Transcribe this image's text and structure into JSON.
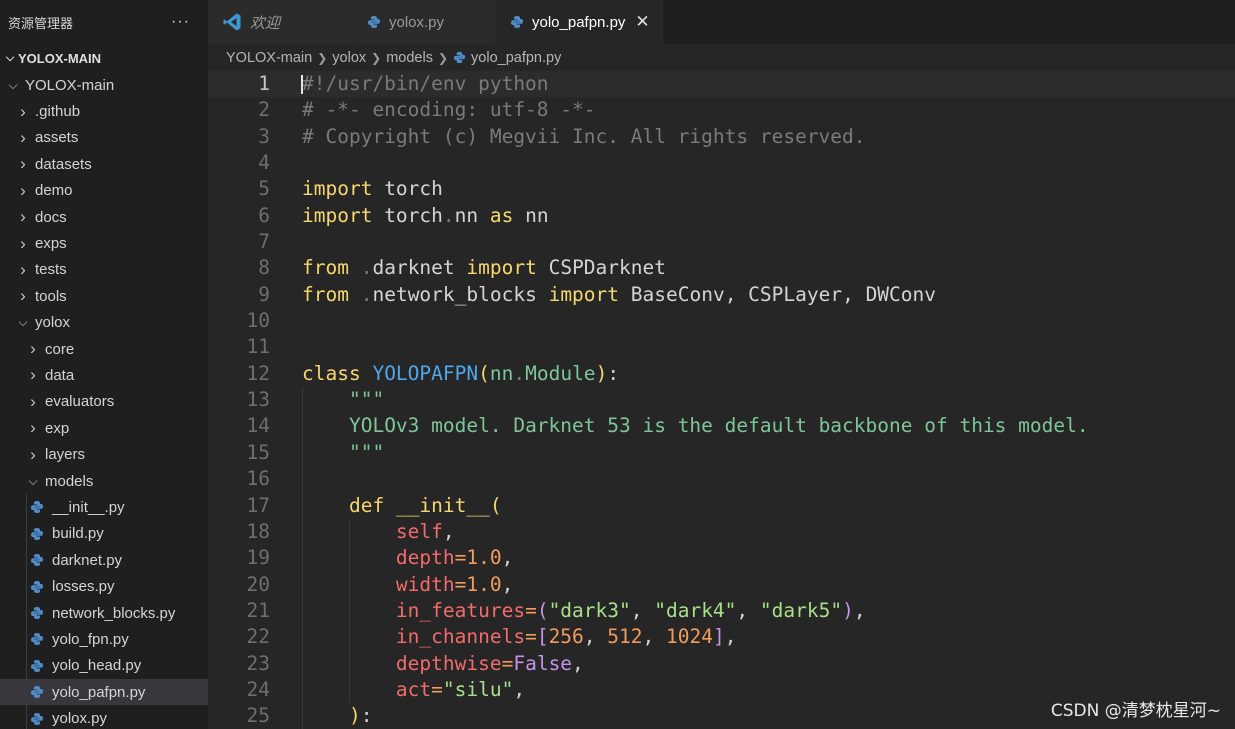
{
  "sidebar": {
    "title": "资源管理器",
    "more": "···",
    "section": "YOLOX-MAIN",
    "tree": [
      {
        "label": "YOLOX-main",
        "depth": 0,
        "kind": "folder",
        "expanded": true
      },
      {
        "label": ".github",
        "depth": 1,
        "kind": "folder",
        "expanded": false
      },
      {
        "label": "assets",
        "depth": 1,
        "kind": "folder",
        "expanded": false
      },
      {
        "label": "datasets",
        "depth": 1,
        "kind": "folder",
        "expanded": false
      },
      {
        "label": "demo",
        "depth": 1,
        "kind": "folder",
        "expanded": false
      },
      {
        "label": "docs",
        "depth": 1,
        "kind": "folder",
        "expanded": false
      },
      {
        "label": "exps",
        "depth": 1,
        "kind": "folder",
        "expanded": false
      },
      {
        "label": "tests",
        "depth": 1,
        "kind": "folder",
        "expanded": false
      },
      {
        "label": "tools",
        "depth": 1,
        "kind": "folder",
        "expanded": false
      },
      {
        "label": "yolox",
        "depth": 1,
        "kind": "folder",
        "expanded": true
      },
      {
        "label": "core",
        "depth": 2,
        "kind": "folder",
        "expanded": false
      },
      {
        "label": "data",
        "depth": 2,
        "kind": "folder",
        "expanded": false
      },
      {
        "label": "evaluators",
        "depth": 2,
        "kind": "folder",
        "expanded": false
      },
      {
        "label": "exp",
        "depth": 2,
        "kind": "folder",
        "expanded": false
      },
      {
        "label": "layers",
        "depth": 2,
        "kind": "folder",
        "expanded": false
      },
      {
        "label": "models",
        "depth": 2,
        "kind": "folder",
        "expanded": true
      },
      {
        "label": "__init__.py",
        "depth": 3,
        "kind": "file"
      },
      {
        "label": "build.py",
        "depth": 3,
        "kind": "file"
      },
      {
        "label": "darknet.py",
        "depth": 3,
        "kind": "file"
      },
      {
        "label": "losses.py",
        "depth": 3,
        "kind": "file"
      },
      {
        "label": "network_blocks.py",
        "depth": 3,
        "kind": "file"
      },
      {
        "label": "yolo_fpn.py",
        "depth": 3,
        "kind": "file"
      },
      {
        "label": "yolo_head.py",
        "depth": 3,
        "kind": "file"
      },
      {
        "label": "yolo_pafpn.py",
        "depth": 3,
        "kind": "file",
        "selected": true
      },
      {
        "label": "yolox.py",
        "depth": 3,
        "kind": "file"
      }
    ]
  },
  "tabs": {
    "welcome": "欢迎",
    "yolox": "yolox.py",
    "pafpn": "yolo_pafpn.py",
    "close": "✕"
  },
  "breadcrumb": {
    "items": [
      "YOLOX-main",
      "yolox",
      "models"
    ],
    "file": "yolo_pafpn.py"
  },
  "code": {
    "current_line": 1,
    "lines": [
      [
        [
          "c-comment",
          "#!/usr/bin/env python"
        ]
      ],
      [
        [
          "c-comment",
          "# -*- encoding: utf-8 -*-"
        ]
      ],
      [
        [
          "c-comment",
          "# Copyright (c) Megvii Inc. All rights reserved."
        ]
      ],
      [],
      [
        [
          "c-kw",
          "import"
        ],
        [
          "c-plain",
          " torch"
        ]
      ],
      [
        [
          "c-kw",
          "import"
        ],
        [
          "c-plain",
          " torch"
        ],
        [
          "c-dot",
          "."
        ],
        [
          "c-plain",
          "nn "
        ],
        [
          "c-kw",
          "as"
        ],
        [
          "c-plain",
          " nn"
        ]
      ],
      [],
      [
        [
          "c-kw",
          "from"
        ],
        [
          "c-plain",
          " "
        ],
        [
          "c-dot",
          "."
        ],
        [
          "c-plain",
          "darknet "
        ],
        [
          "c-kw",
          "import"
        ],
        [
          "c-plain",
          " CSPDarknet"
        ]
      ],
      [
        [
          "c-kw",
          "from"
        ],
        [
          "c-plain",
          " "
        ],
        [
          "c-dot",
          "."
        ],
        [
          "c-plain",
          "network_blocks "
        ],
        [
          "c-kw",
          "import"
        ],
        [
          "c-plain",
          " BaseConv, CSPLayer, DWConv"
        ]
      ],
      [],
      [],
      [
        [
          "c-kw",
          "class"
        ],
        [
          "c-plain",
          " "
        ],
        [
          "c-class",
          "YOLOPAFPN"
        ],
        [
          "c-paren",
          "("
        ],
        [
          "c-green",
          "nn"
        ],
        [
          "c-dot",
          "."
        ],
        [
          "c-green",
          "Module"
        ],
        [
          "c-paren",
          ")"
        ],
        [
          "c-plain",
          ":"
        ]
      ],
      [
        [
          "c-plain",
          "    "
        ],
        [
          "c-green",
          "\"\"\""
        ]
      ],
      [
        [
          "c-plain",
          "    "
        ],
        [
          "c-green",
          "YOLOv3 model. Darknet 53 is the default backbone of this model."
        ]
      ],
      [
        [
          "c-plain",
          "    "
        ],
        [
          "c-green",
          "\"\"\""
        ]
      ],
      [],
      [
        [
          "c-plain",
          "    "
        ],
        [
          "c-kw",
          "def"
        ],
        [
          "c-plain",
          " "
        ],
        [
          "c-kw",
          "__init__"
        ],
        [
          "c-paren",
          "("
        ]
      ],
      [
        [
          "c-plain",
          "        "
        ],
        [
          "c-param",
          "self"
        ],
        [
          "c-plain",
          ","
        ]
      ],
      [
        [
          "c-plain",
          "        "
        ],
        [
          "c-param",
          "depth"
        ],
        [
          "c-op",
          "="
        ],
        [
          "c-num",
          "1.0"
        ],
        [
          "c-plain",
          ","
        ]
      ],
      [
        [
          "c-plain",
          "        "
        ],
        [
          "c-param",
          "width"
        ],
        [
          "c-op",
          "="
        ],
        [
          "c-num",
          "1.0"
        ],
        [
          "c-plain",
          ","
        ]
      ],
      [
        [
          "c-plain",
          "        "
        ],
        [
          "c-param",
          "in_features"
        ],
        [
          "c-op",
          "="
        ],
        [
          "c-bracket",
          "("
        ],
        [
          "c-str",
          "\"dark3\""
        ],
        [
          "c-plain",
          ", "
        ],
        [
          "c-str",
          "\"dark4\""
        ],
        [
          "c-plain",
          ", "
        ],
        [
          "c-str",
          "\"dark5\""
        ],
        [
          "c-bracket",
          ")"
        ],
        [
          "c-plain",
          ","
        ]
      ],
      [
        [
          "c-plain",
          "        "
        ],
        [
          "c-param",
          "in_channels"
        ],
        [
          "c-op",
          "="
        ],
        [
          "c-bracket",
          "["
        ],
        [
          "c-num",
          "256"
        ],
        [
          "c-plain",
          ", "
        ],
        [
          "c-num",
          "512"
        ],
        [
          "c-plain",
          ", "
        ],
        [
          "c-num",
          "1024"
        ],
        [
          "c-bracket",
          "]"
        ],
        [
          "c-plain",
          ","
        ]
      ],
      [
        [
          "c-plain",
          "        "
        ],
        [
          "c-param",
          "depthwise"
        ],
        [
          "c-op",
          "="
        ],
        [
          "c-bool",
          "False"
        ],
        [
          "c-plain",
          ","
        ]
      ],
      [
        [
          "c-plain",
          "        "
        ],
        [
          "c-param",
          "act"
        ],
        [
          "c-op",
          "="
        ],
        [
          "c-str",
          "\"silu\""
        ],
        [
          "c-plain",
          ","
        ]
      ],
      [
        [
          "c-plain",
          "    "
        ],
        [
          "c-paren",
          ")"
        ],
        [
          "c-plain",
          ":"
        ]
      ]
    ]
  },
  "watermark": "CSDN @清梦枕星河~",
  "colors": {
    "sidebar_bg": "#1f1f1f",
    "editor_bg": "#262626",
    "keyword": "#f5d76e",
    "class_name": "#4fa6ea",
    "string": "#a6e089",
    "param": "#f26b6b",
    "number": "#f29b5c",
    "vscode_blue": "#3c99d4",
    "python_blue": "#4f8cc9"
  }
}
